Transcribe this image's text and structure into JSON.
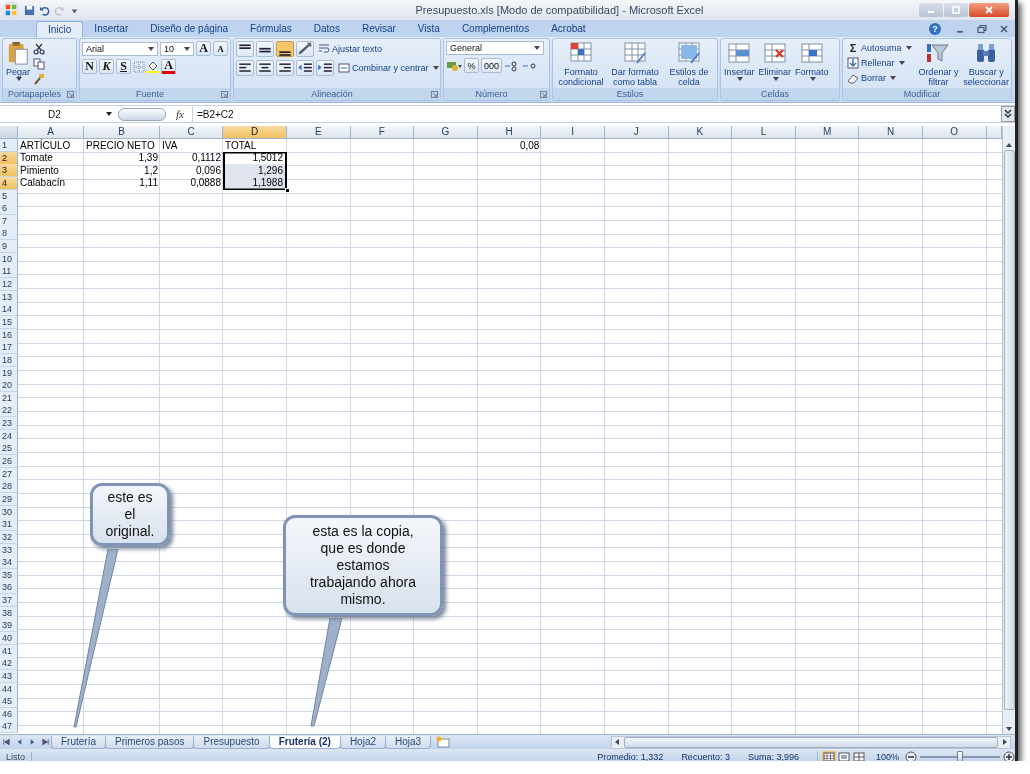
{
  "window": {
    "title": "Presupuesto.xls  [Modo de compatibilidad] - Microsoft Excel"
  },
  "ribbon_tabs": [
    {
      "label": "Inicio",
      "selected": true
    },
    {
      "label": "Insertar",
      "selected": false
    },
    {
      "label": "Diseño de página",
      "selected": false
    },
    {
      "label": "Fórmulas",
      "selected": false
    },
    {
      "label": "Datos",
      "selected": false
    },
    {
      "label": "Revisar",
      "selected": false
    },
    {
      "label": "Vista",
      "selected": false
    },
    {
      "label": "Complementos",
      "selected": false
    },
    {
      "label": "Acrobat",
      "selected": false
    }
  ],
  "help": "?",
  "ribbon": {
    "clipboard": {
      "label": "Portapapeles",
      "paste": "Pegar"
    },
    "font": {
      "label": "Fuente",
      "family": "Arial",
      "size": "10",
      "grow": "A",
      "shrink": "A",
      "bold": "N",
      "italic": "K",
      "underline": "S",
      "font_color": "A"
    },
    "alignment": {
      "label": "Alineación",
      "vertical_align": [
        {
          "selected": false
        },
        {
          "selected": false
        },
        {
          "selected": true
        }
      ],
      "wrap": "Ajustar texto",
      "merge": "Combinar y centrar"
    },
    "number": {
      "label": "Número",
      "format": "General",
      "percent": "%",
      "thousands": "000"
    },
    "styles": {
      "label": "Estilos",
      "buttons": [
        "Formato condicional",
        "Dar formato como tabla",
        "Estilos de celda"
      ]
    },
    "cells": {
      "label": "Celdas",
      "buttons": [
        "Insertar",
        "Eliminar",
        "Formato"
      ]
    },
    "editing": {
      "label": "Modificar",
      "autosum_icon": "Σ",
      "small": [
        "Autosuma",
        "Rellenar",
        "Borrar"
      ],
      "big": [
        "Ordenar y filtrar",
        "Buscar y seleccionar"
      ]
    }
  },
  "formula_bar": {
    "name_box": "D2",
    "function_icon": "fx",
    "formula": "=B2+C2"
  },
  "sheet": {
    "columns": [
      "A",
      "B",
      "C",
      "D",
      "E",
      "F",
      "G",
      "H",
      "I",
      "J",
      "K",
      "L",
      "M",
      "N",
      "O"
    ],
    "rows": [
      {
        "number": "1",
        "cells": [
          {
            "text": "ARTÍCULO",
            "numeric": false,
            "selected": false
          },
          {
            "text": "PRECIO NETO",
            "numeric": false,
            "selected": false
          },
          {
            "text": "IVA",
            "numeric": false,
            "selected": false
          },
          {
            "text": "TOTAL",
            "numeric": false,
            "selected": false
          },
          null,
          null,
          null,
          {
            "text": "0,08",
            "numeric": true,
            "selected": false
          }
        ]
      },
      {
        "number": "2",
        "cells": [
          {
            "text": "Tomate",
            "numeric": false,
            "selected": false
          },
          {
            "text": "1,39",
            "numeric": true,
            "selected": false
          },
          {
            "text": "0,1112",
            "numeric": true,
            "selected": false
          },
          {
            "text": "1,5012",
            "numeric": true,
            "selected": true
          }
        ]
      },
      {
        "number": "3",
        "cells": [
          {
            "text": "Pimiento",
            "numeric": false,
            "selected": false
          },
          {
            "text": "1,2",
            "numeric": true,
            "selected": false
          },
          {
            "text": "0,096",
            "numeric": true,
            "selected": false
          },
          {
            "text": "1,296",
            "numeric": true,
            "selected": true
          }
        ]
      },
      {
        "number": "4",
        "cells": [
          {
            "text": "Calabacín",
            "numeric": false,
            "selected": false
          },
          {
            "text": "1,11",
            "numeric": true,
            "selected": false
          },
          {
            "text": "0,0888",
            "numeric": true,
            "selected": false
          },
          {
            "text": "1,1988",
            "numeric": true,
            "selected": true
          }
        ]
      },
      {
        "number": "5"
      },
      {
        "number": "6"
      },
      {
        "number": "7"
      },
      {
        "number": "8"
      },
      {
        "number": "9"
      },
      {
        "number": "10"
      },
      {
        "number": "11"
      },
      {
        "number": "12"
      },
      {
        "number": "13"
      },
      {
        "number": "14"
      },
      {
        "number": "15"
      },
      {
        "number": "16"
      },
      {
        "number": "17"
      },
      {
        "number": "18"
      },
      {
        "number": "19"
      },
      {
        "number": "20"
      },
      {
        "number": "21"
      },
      {
        "number": "22"
      },
      {
        "number": "23"
      },
      {
        "number": "24"
      },
      {
        "number": "25"
      },
      {
        "number": "26"
      },
      {
        "number": "27"
      },
      {
        "number": "28"
      },
      {
        "number": "29"
      },
      {
        "number": "30"
      },
      {
        "number": "31"
      },
      {
        "number": "32"
      },
      {
        "number": "33"
      },
      {
        "number": "34"
      },
      {
        "number": "35"
      },
      {
        "number": "36"
      },
      {
        "number": "37"
      },
      {
        "number": "38"
      },
      {
        "number": "39"
      },
      {
        "number": "40"
      },
      {
        "number": "41"
      },
      {
        "number": "42"
      },
      {
        "number": "43"
      },
      {
        "number": "44"
      },
      {
        "number": "45"
      },
      {
        "number": "46"
      },
      {
        "number": "47"
      }
    ]
  },
  "callouts": [
    {
      "text": "este es el original."
    },
    {
      "text": "esta es la copia, que es donde estamos trabajando ahora mismo."
    }
  ],
  "sheet_tabs": [
    {
      "label": "Frutería",
      "selected": false
    },
    {
      "label": "Primeros pasos",
      "selected": false
    },
    {
      "label": "Presupuesto",
      "selected": false
    },
    {
      "label": "Frutería (2)",
      "selected": true
    },
    {
      "label": "Hoja2",
      "selected": false
    },
    {
      "label": "Hoja3",
      "selected": false
    }
  ],
  "status_bar": {
    "mode": "Listo",
    "stats": [
      "Promedio: 1,332",
      "Recuento: 3",
      "Suma: 3,996"
    ],
    "views": [
      {
        "selected": true
      },
      {
        "selected": false
      },
      {
        "selected": false
      }
    ],
    "zoom": "100%",
    "zoom_slider": {
      "level": 0.5
    }
  }
}
